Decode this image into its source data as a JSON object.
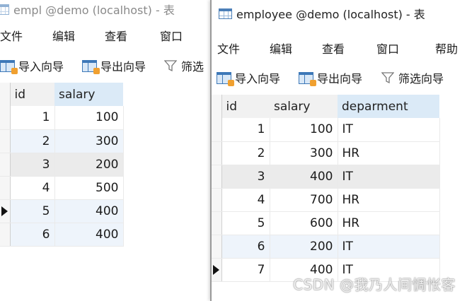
{
  "window_a": {
    "title": "empl @demo (localhost) - 表",
    "menu": [
      "文件",
      "编辑",
      "查看",
      "窗口"
    ],
    "toolbar": {
      "import_label": "导入向导",
      "export_label": "导出向导",
      "filter_label": "筛选"
    },
    "columns": [
      "id",
      "salary"
    ],
    "rows": [
      {
        "id": "1",
        "salary": "100"
      },
      {
        "id": "2",
        "salary": "300"
      },
      {
        "id": "3",
        "salary": "200"
      },
      {
        "id": "4",
        "salary": "500"
      },
      {
        "id": "5",
        "salary": "400"
      },
      {
        "id": "6",
        "salary": "400"
      }
    ]
  },
  "window_b": {
    "title": "employee @demo (localhost) - 表",
    "menu": [
      "文件",
      "编辑",
      "查看",
      "窗口",
      "帮助"
    ],
    "toolbar": {
      "import_label": "导入向导",
      "export_label": "导出向导",
      "filter_label": "筛选向导"
    },
    "columns": [
      "id",
      "salary",
      "deparment"
    ],
    "rows": [
      {
        "id": "1",
        "salary": "100",
        "deparment": "IT"
      },
      {
        "id": "2",
        "salary": "300",
        "deparment": "HR"
      },
      {
        "id": "3",
        "salary": "400",
        "deparment": "IT"
      },
      {
        "id": "4",
        "salary": "700",
        "deparment": "HR"
      },
      {
        "id": "5",
        "salary": "600",
        "deparment": "HR"
      },
      {
        "id": "6",
        "salary": "200",
        "deparment": "IT"
      },
      {
        "id": "7",
        "salary": "400",
        "deparment": "IT"
      }
    ]
  },
  "watermark": "CSDN @我乃人间惆怅客"
}
